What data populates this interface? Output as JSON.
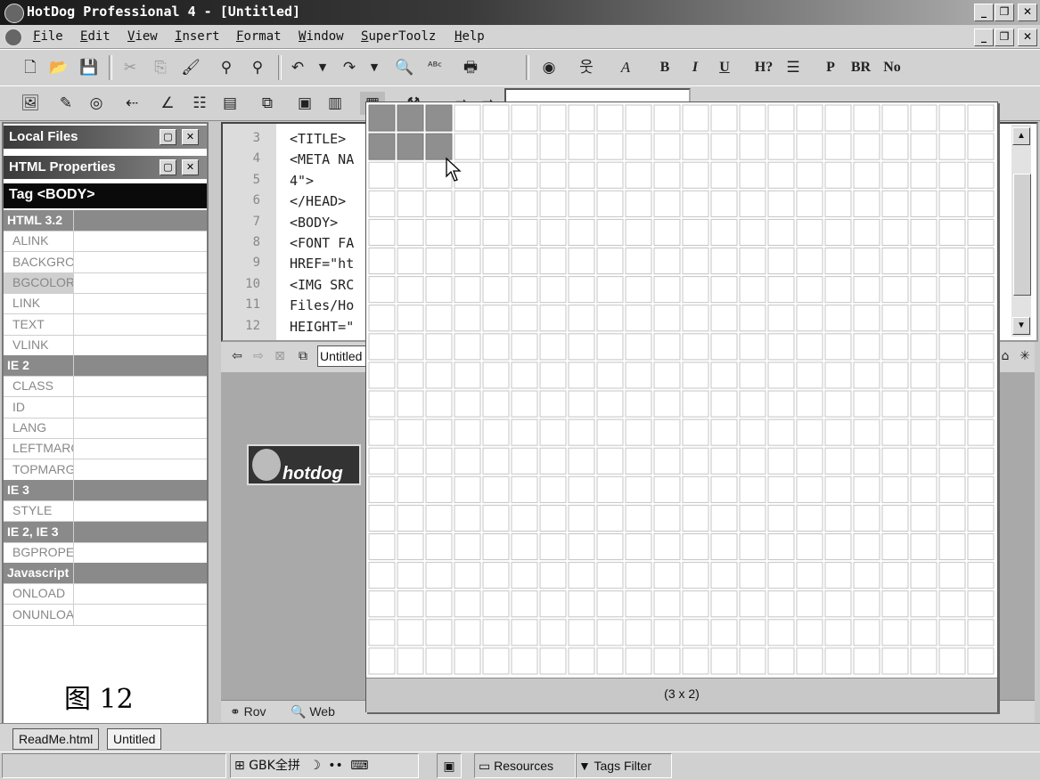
{
  "window": {
    "title": "HotDog Professional 4 - [Untitled]",
    "min": "_",
    "max": "❐",
    "close": "✕"
  },
  "menu": [
    "File",
    "Edit",
    "View",
    "Insert",
    "Format",
    "Window",
    "SuperToolz",
    "Help"
  ],
  "format_toolbar": {
    "bold": "B",
    "italic": "I",
    "underline": "U",
    "heading": "H?",
    "para": "P",
    "br": "BR",
    "nobr": "No"
  },
  "panels": {
    "local_files": "Local Files",
    "html_properties": "HTML Properties",
    "tag": "Tag <BODY>"
  },
  "properties": [
    {
      "label": "HTML 3.2",
      "group": true
    },
    {
      "label": "ALINK"
    },
    {
      "label": "BACKGROUND"
    },
    {
      "label": "BGCOLOR",
      "selected": true
    },
    {
      "label": "LINK"
    },
    {
      "label": "TEXT"
    },
    {
      "label": "VLINK"
    },
    {
      "label": "IE 2",
      "group": true
    },
    {
      "label": "CLASS"
    },
    {
      "label": "ID"
    },
    {
      "label": "LANG"
    },
    {
      "label": "LEFTMARGIN"
    },
    {
      "label": "TOPMARGIN"
    },
    {
      "label": "IE 3",
      "group": true
    },
    {
      "label": "STYLE"
    },
    {
      "label": "IE 2, IE 3",
      "group": true
    },
    {
      "label": "BGPROPERTIES"
    },
    {
      "label": "Javascript",
      "group": true
    },
    {
      "label": "ONLOAD"
    },
    {
      "label": "ONUNLOAD"
    }
  ],
  "caption": "图 12",
  "editor": {
    "lines": [
      {
        "n": "3",
        "code": "<TITLE>"
      },
      {
        "n": "4",
        "code": "<META NA"
      },
      {
        "n": "5",
        "code": "4\">"
      },
      {
        "n": "6",
        "code": "</HEAD>"
      },
      {
        "n": "7",
        "code": "<BODY>"
      },
      {
        "n": "8",
        "code": "<FONT FA"
      },
      {
        "n": "9",
        "code": "HREF=\"ht"
      },
      {
        "n": "10",
        "code": "<IMG SRC"
      },
      {
        "n": "11",
        "code": "Files/Ho"
      },
      {
        "n": "12",
        "code": "HEIGHT=\""
      }
    ]
  },
  "preview": {
    "url": "Untitled",
    "logo_text": "hotdog"
  },
  "bottom_tabs": [
    "Rov",
    "Web"
  ],
  "file_tabs": [
    "ReadMe.html",
    "Untitled"
  ],
  "status": {
    "ime": "GBK全拼",
    "resources": "Resources",
    "tags_filter": "Tags Filter"
  },
  "table_picker": {
    "columns": 22,
    "rows": 20,
    "selected_cols": 3,
    "selected_rows": 2,
    "label": "(3 x 2)"
  },
  "colors": {
    "highlight": "#8f8f8f",
    "grid_line": "#c4c4c4",
    "title_dark": "#1a1a1a"
  }
}
